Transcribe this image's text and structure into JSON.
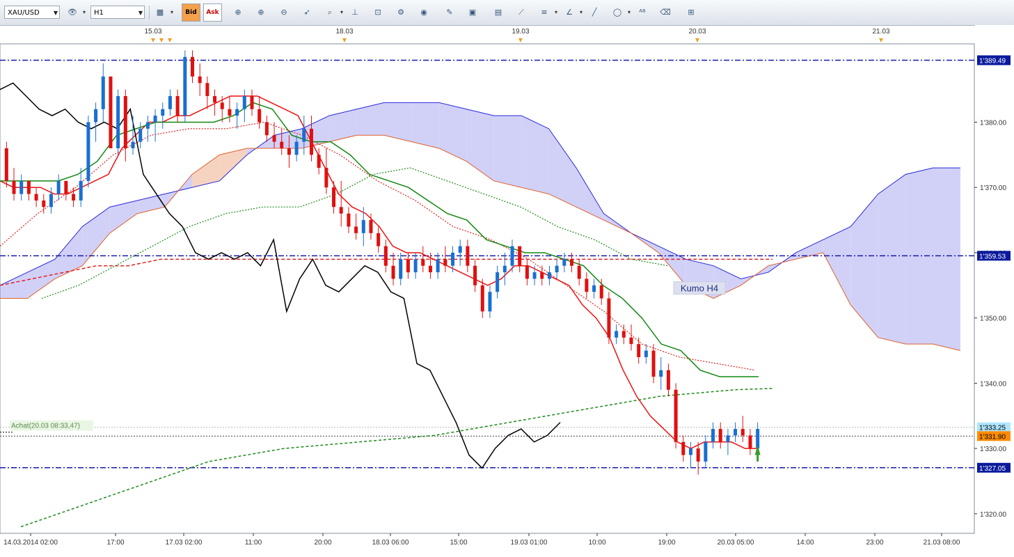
{
  "toolbar": {
    "symbol": "XAU/USD",
    "timeframe": "H1",
    "bid_label": "Bid",
    "ask_label": "Ask",
    "icons": [
      "crosshair-icon",
      "zoom-in-icon",
      "zoom-out-icon",
      "cursor-icon",
      "zoom-box-icon",
      "vertical-line-icon",
      "properties-icon",
      "indicators-icon",
      "globe-icon",
      "ruler-icon",
      "screenshot-icon",
      "template-icon",
      "drawing-tools-icon",
      "lines-icon",
      "trendline-icon",
      "pen-icon",
      "ellipse-icon",
      "text-icon",
      "eraser-icon",
      "hierarchy-icon"
    ]
  },
  "chart_data": {
    "type": "candlestick",
    "symbol": "XAU/USD",
    "timeframe": "H1",
    "ylim": [
      1317,
      1392
    ],
    "y_ticks": [
      "1'380.00",
      "1'370.00",
      "1'360.00",
      "1'350.00",
      "1'340.00",
      "1'330.00",
      "1'320.00"
    ],
    "x_ticks": [
      "14.03.2014 02:00",
      "17:00",
      "17.03 02:00",
      "11:00",
      "20:00",
      "18.03 06:00",
      "15:00",
      "19.03 01:00",
      "10:00",
      "19:00",
      "20.03 05:00",
      "14:00",
      "23:00",
      "21.03 08:00"
    ],
    "day_markers": [
      "15.03",
      "18.03",
      "19.03",
      "20.03",
      "21.03"
    ],
    "price_labels": [
      {
        "text": "1'389.49",
        "value": 1389.49,
        "bg": "#0a1a9c",
        "fg": "#ffffff"
      },
      {
        "text": "1'359.53",
        "value": 1359.53,
        "bg": "#0a1a9c",
        "fg": "#ffffff"
      },
      {
        "text": "1'333.25",
        "value": 1333.25,
        "bg": "#aee6ff",
        "fg": "#000000"
      },
      {
        "text": "1'331.90",
        "value": 1331.9,
        "bg": "#ff8c00",
        "fg": "#000000"
      },
      {
        "text": "1'327.05",
        "value": 1327.05,
        "bg": "#0a1a9c",
        "fg": "#ffffff"
      }
    ],
    "horizontal_levels": [
      1389.49,
      1359.53,
      1327.05
    ],
    "annotations": {
      "kumo_label": "Kumo H4",
      "trade_label": "Achat(20.03 08:33,47)",
      "trade_price": 1333.47
    },
    "candles": [
      [
        1376,
        1377,
        1370,
        1371
      ],
      [
        1371,
        1373,
        1368,
        1369
      ],
      [
        1369,
        1372,
        1368,
        1371
      ],
      [
        1371,
        1371,
        1368,
        1369
      ],
      [
        1369,
        1370,
        1367,
        1368
      ],
      [
        1368,
        1369,
        1366,
        1367
      ],
      [
        1367,
        1370,
        1366,
        1369
      ],
      [
        1369,
        1372,
        1368,
        1371
      ],
      [
        1371,
        1370,
        1368,
        1369
      ],
      [
        1369,
        1370,
        1367,
        1368
      ],
      [
        1368,
        1373,
        1367,
        1371
      ],
      [
        1371,
        1381,
        1370,
        1380
      ],
      [
        1380,
        1383,
        1377,
        1382
      ],
      [
        1382,
        1389,
        1380,
        1387
      ],
      [
        1387,
        1386,
        1378,
        1376
      ],
      [
        1376,
        1385,
        1375,
        1384
      ],
      [
        1384,
        1385,
        1374,
        1376
      ],
      [
        1376,
        1381,
        1375,
        1377
      ],
      [
        1377,
        1380,
        1376,
        1379
      ],
      [
        1379,
        1381,
        1377,
        1380
      ],
      [
        1380,
        1382,
        1377,
        1381
      ],
      [
        1381,
        1383,
        1379,
        1382
      ],
      [
        1382,
        1385,
        1381,
        1384
      ],
      [
        1384,
        1385,
        1380,
        1381
      ],
      [
        1381,
        1391,
        1380,
        1390
      ],
      [
        1390,
        1391,
        1386,
        1387
      ],
      [
        1387,
        1389,
        1384,
        1386
      ],
      [
        1386,
        1387,
        1382,
        1384
      ],
      [
        1384,
        1385,
        1381,
        1383
      ],
      [
        1383,
        1384,
        1380,
        1382
      ],
      [
        1382,
        1384,
        1380,
        1381
      ],
      [
        1381,
        1383,
        1379,
        1382
      ],
      [
        1382,
        1385,
        1380,
        1384
      ],
      [
        1384,
        1385,
        1381,
        1382
      ],
      [
        1382,
        1384,
        1379,
        1380
      ],
      [
        1380,
        1381,
        1377,
        1378
      ],
      [
        1378,
        1380,
        1376,
        1377
      ],
      [
        1377,
        1379,
        1375,
        1376
      ],
      [
        1376,
        1378,
        1373,
        1375
      ],
      [
        1375,
        1378,
        1374,
        1377
      ],
      [
        1377,
        1381,
        1375,
        1379
      ],
      [
        1379,
        1381,
        1374,
        1375
      ],
      [
        1375,
        1376,
        1372,
        1373
      ],
      [
        1373,
        1376,
        1369,
        1370
      ],
      [
        1370,
        1371,
        1366,
        1367
      ],
      [
        1367,
        1371,
        1364,
        1366
      ],
      [
        1366,
        1367,
        1363,
        1364
      ],
      [
        1364,
        1366,
        1362,
        1363
      ],
      [
        1363,
        1367,
        1361,
        1365
      ],
      [
        1365,
        1366,
        1362,
        1363
      ],
      [
        1363,
        1364,
        1360,
        1361
      ],
      [
        1361,
        1362,
        1357,
        1358
      ],
      [
        1358,
        1360,
        1355,
        1356
      ],
      [
        1356,
        1360,
        1355,
        1359
      ],
      [
        1359,
        1360,
        1356,
        1357
      ],
      [
        1357,
        1360,
        1356,
        1359
      ],
      [
        1359,
        1361,
        1357,
        1358
      ],
      [
        1358,
        1360,
        1356,
        1357
      ],
      [
        1357,
        1360,
        1356,
        1359
      ],
      [
        1359,
        1361,
        1357,
        1358
      ],
      [
        1358,
        1361,
        1357,
        1360
      ],
      [
        1360,
        1362,
        1358,
        1361
      ],
      [
        1361,
        1362,
        1357,
        1358
      ],
      [
        1358,
        1359,
        1354,
        1355
      ],
      [
        1355,
        1356,
        1350,
        1351
      ],
      [
        1351,
        1355,
        1350,
        1354
      ],
      [
        1354,
        1358,
        1353,
        1357
      ],
      [
        1357,
        1360,
        1355,
        1358
      ],
      [
        1358,
        1362,
        1357,
        1361
      ],
      [
        1361,
        1361,
        1357,
        1358
      ],
      [
        1358,
        1359,
        1355,
        1356
      ],
      [
        1356,
        1358,
        1355,
        1357
      ],
      [
        1357,
        1358,
        1355,
        1356
      ],
      [
        1356,
        1358,
        1355,
        1357
      ],
      [
        1357,
        1359,
        1356,
        1358
      ],
      [
        1358,
        1360,
        1357,
        1359
      ],
      [
        1359,
        1360,
        1357,
        1358
      ],
      [
        1358,
        1359,
        1355,
        1356
      ],
      [
        1356,
        1357,
        1353,
        1354
      ],
      [
        1354,
        1356,
        1353,
        1355
      ],
      [
        1355,
        1356,
        1352,
        1353
      ],
      [
        1353,
        1354,
        1346,
        1347
      ],
      [
        1347,
        1349,
        1346,
        1348
      ],
      [
        1348,
        1349,
        1346,
        1347
      ],
      [
        1347,
        1349,
        1345,
        1346
      ],
      [
        1346,
        1347,
        1343,
        1344
      ],
      [
        1344,
        1346,
        1343,
        1345
      ],
      [
        1345,
        1346,
        1340,
        1341
      ],
      [
        1341,
        1344,
        1339,
        1342
      ],
      [
        1342,
        1343,
        1338,
        1339
      ],
      [
        1339,
        1340,
        1330,
        1331
      ],
      [
        1331,
        1332,
        1328,
        1329
      ],
      [
        1329,
        1331,
        1327,
        1330
      ],
      [
        1330,
        1331,
        1326,
        1328
      ],
      [
        1328,
        1332,
        1327,
        1331
      ],
      [
        1331,
        1334,
        1330,
        1333
      ],
      [
        1333,
        1334,
        1330,
        1331
      ],
      [
        1331,
        1333,
        1329,
        1332
      ],
      [
        1332,
        1334,
        1331,
        1333
      ],
      [
        1333,
        1335,
        1331,
        1332
      ],
      [
        1332,
        1333,
        1329,
        1330
      ],
      [
        1330,
        1334,
        1329,
        1333
      ]
    ],
    "ichimoku_lines": {
      "tenkan_sen": [
        1371,
        1370,
        1370,
        1370,
        1369,
        1369,
        1370,
        1371,
        1372,
        1376,
        1378,
        1380,
        1380,
        1381,
        1381,
        1382,
        1383,
        1384,
        1384,
        1384,
        1383,
        1382,
        1381,
        1377,
        1373,
        1369,
        1367,
        1366,
        1364,
        1361,
        1360,
        1360,
        1359,
        1358,
        1357,
        1356,
        1355,
        1356,
        1358,
        1358,
        1357,
        1356,
        1355,
        1352,
        1350,
        1347,
        1342,
        1338,
        1335,
        1333,
        1331,
        1330,
        1331,
        1331,
        1331,
        1330,
        1330
      ],
      "kijun_sen": [
        1371,
        1371,
        1371,
        1371,
        1372,
        1374,
        1378,
        1379,
        1380,
        1380,
        1380,
        1380,
        1381,
        1383,
        1382,
        1378,
        1377,
        1377,
        1375,
        1372,
        1371,
        1370,
        1368,
        1366,
        1365,
        1362,
        1361,
        1360,
        1360,
        1359,
        1358,
        1355,
        1353,
        1350,
        1346,
        1345,
        1342,
        1341,
        1341,
        1341
      ],
      "chikou_span": [
        1385,
        1386,
        1384,
        1382,
        1381,
        1382,
        1380,
        1379,
        1380,
        1379,
        1382,
        1372,
        1369,
        1366,
        1364,
        1360,
        1359,
        1360,
        1359,
        1360,
        1358,
        1362,
        1351,
        1356,
        1359,
        1355,
        1354,
        1356,
        1358,
        1357,
        1354,
        1353,
        1343,
        1342,
        1338,
        1334,
        1329,
        1327,
        1330,
        1332,
        1333,
        1331,
        1332,
        1334
      ]
    },
    "h4_kumo": {
      "senkou_a": [
        1355,
        1357,
        1359,
        1364,
        1367,
        1368,
        1369,
        1370,
        1371,
        1375,
        1378,
        1379,
        1381,
        1382,
        1383,
        1383,
        1383,
        1382,
        1381,
        1381,
        1379,
        1373,
        1366,
        1363,
        1361,
        1359,
        1358,
        1356,
        1357,
        1360,
        1362,
        1364,
        1369,
        1372,
        1373,
        1373
      ],
      "senkou_b": [
        1353,
        1353,
        1356,
        1358,
        1363,
        1366,
        1367,
        1372,
        1375,
        1376,
        1376,
        1376,
        1377,
        1378,
        1378,
        1377,
        1376,
        1374,
        1371,
        1370,
        1369,
        1367,
        1365,
        1363,
        1360,
        1355,
        1353,
        1355,
        1358,
        1359,
        1360,
        1352,
        1347,
        1346,
        1346,
        1345
      ]
    }
  }
}
